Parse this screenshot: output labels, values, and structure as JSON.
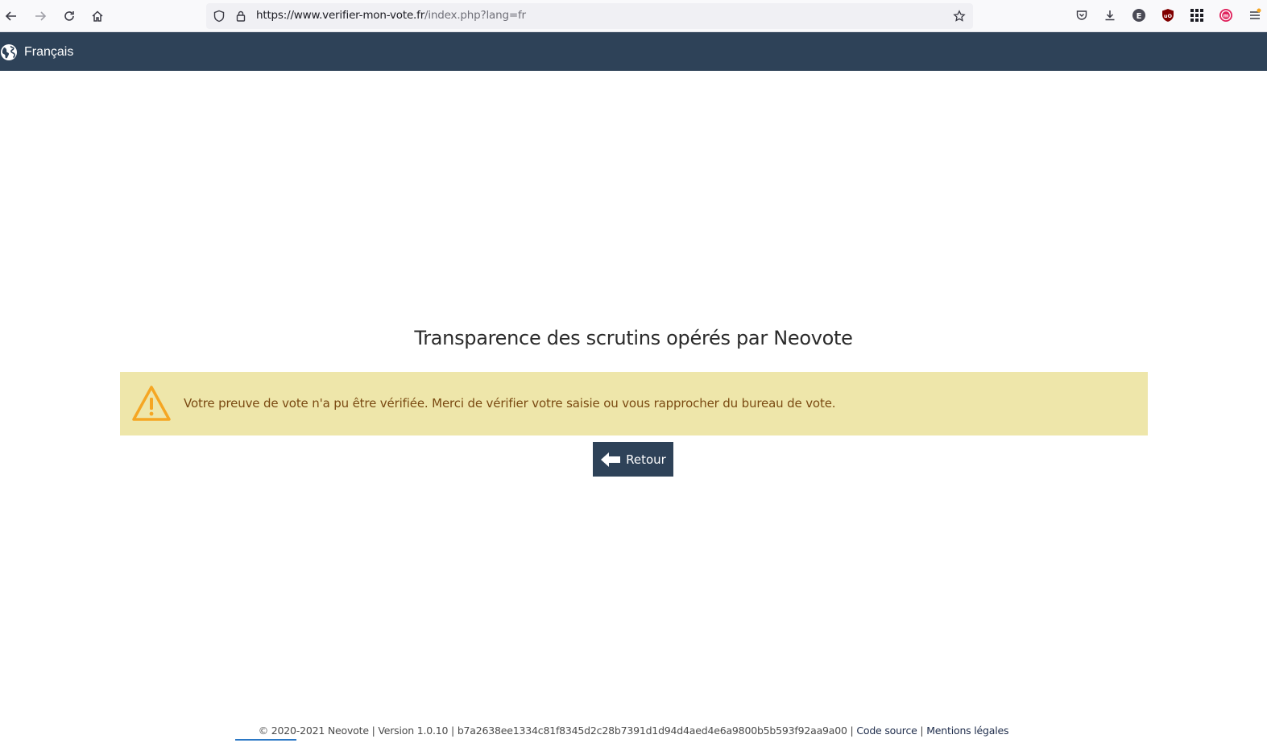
{
  "browser": {
    "url_domain": "https://www.verifier-mon-vote.fr",
    "url_path": "/index.php?lang=fr"
  },
  "nav": {
    "language_label": "Français"
  },
  "main": {
    "title": "Transparence des scrutins opérés par Neovote",
    "alert_message": "Votre preuve de vote n'a pu être vérifiée. Merci de vérifier votre saisie ou vous rapprocher du bureau de vote.",
    "back_button_label": "Retour"
  },
  "footer": {
    "copyright": "© 2020-2021 Neovote | Version 1.0.10 | b7a2638ee1334c81f8345d2c28b7391d1d94d4aed4e6a9800b5b593f92aa9a00 |",
    "source_link": "Code source",
    "legal_link": "Mentions légales"
  },
  "colors": {
    "nav_bg": "#2e4258",
    "alert_bg": "#eee6aa",
    "alert_text": "#7a4a12",
    "warning_icon": "#f5a623"
  },
  "icons": {
    "globe": "globe-icon",
    "warning": "warning-triangle-icon",
    "back": "arrow-left-icon"
  }
}
